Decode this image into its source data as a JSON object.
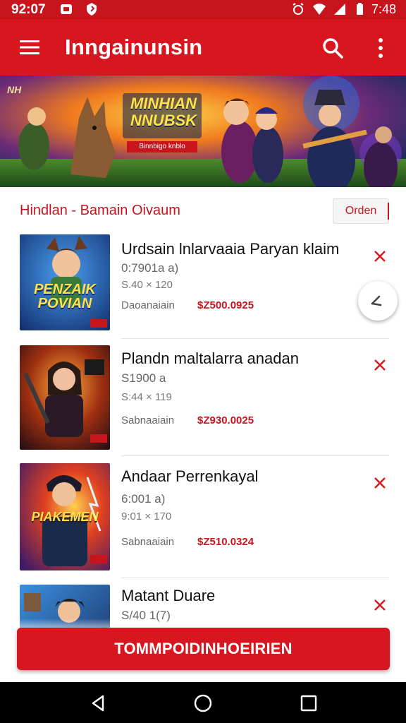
{
  "status_bar": {
    "time_left": "92:07",
    "time_right": "7:48"
  },
  "app_bar": {
    "title": "Inngainunsin"
  },
  "banner": {
    "logo_line1": "MINHIAN",
    "logo_line2": "NNUBSK",
    "logo_ribbon": "Binnbigo knblo",
    "badge": "NH"
  },
  "section": {
    "title": "Hindlan - Bamain Oivaum",
    "order_button": "Orden"
  },
  "items": [
    {
      "title": "Urdsain lnlarvaaia Paryan klaim",
      "subtitle": "0:7901a a)",
      "dimensions": "S.40 × 120",
      "label": "Daoanaiain",
      "price": "$Z500.0925",
      "thumb_text": "PENZAIK POVIAN"
    },
    {
      "title": "Plandn maltalarra anadan",
      "subtitle": "S1900 a",
      "dimensions": "S:44 × 119",
      "label": "Sabnaaiain",
      "price": "$Z930.0025",
      "thumb_text": ""
    },
    {
      "title": "Andaar Perrenkayal",
      "subtitle": "6:001 a)",
      "dimensions": "9:01 × 170",
      "label": "Sabnaaiain",
      "price": "$Z510.0324",
      "thumb_text": "PIAKEMEN"
    },
    {
      "title": "Matant Duare",
      "subtitle": "S/40 1(7)",
      "dimensions": "",
      "label": "",
      "price": "",
      "thumb_text": ""
    }
  ],
  "main_button": {
    "label": "TOMMPOIDINHOEIRIEN"
  },
  "colors": {
    "primary": "#d8161f",
    "status": "#c8141c",
    "price": "#c8141c"
  },
  "icons": [
    "menu-icon",
    "search-icon",
    "more-vert-icon",
    "close-icon",
    "pencil-icon",
    "back-icon",
    "home-icon",
    "recents-icon"
  ]
}
